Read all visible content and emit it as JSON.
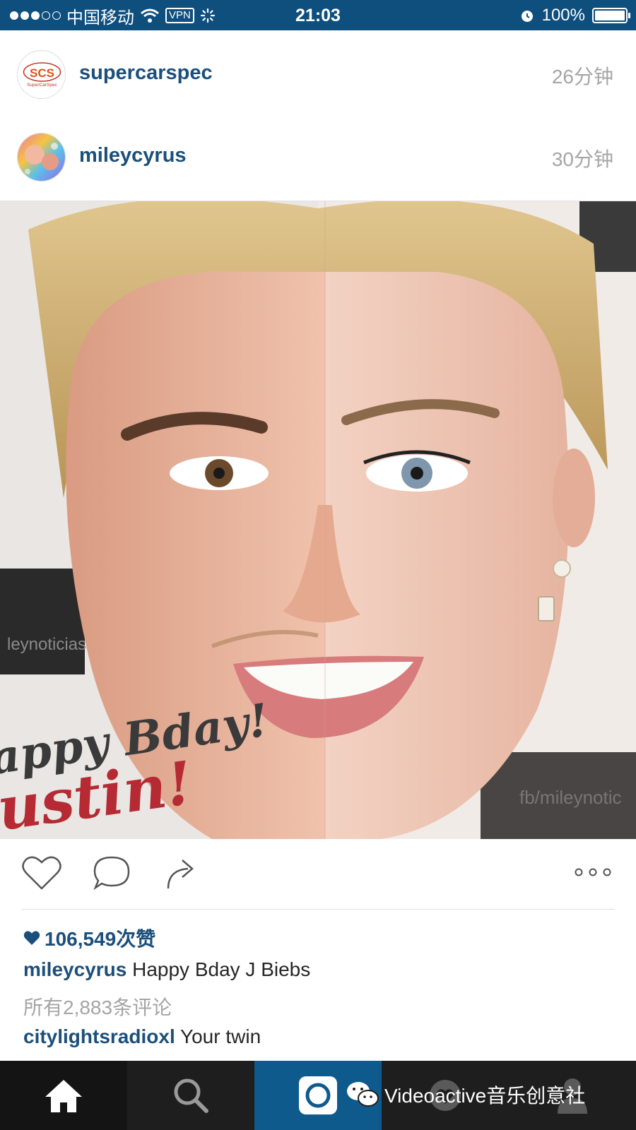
{
  "status_bar": {
    "carrier": "中国移动",
    "vpn": "VPN",
    "time": "21:03",
    "battery_text": "100%",
    "battery_level": 1.0,
    "signal_bars": 3,
    "signal_total": 5
  },
  "posts": [
    {
      "username": "supercarspec",
      "time_ago": "26分钟",
      "avatar_text": "SCS",
      "avatar_sub": "SuperCarSpec"
    },
    {
      "username": "mileycyrus",
      "time_ago": "30分钟"
    }
  ],
  "photo": {
    "overlay_line1": "appy Bday!",
    "overlay_line2": "ustin!",
    "watermark_left": "leynoticias",
    "watermark_right": "fb/mileynotic"
  },
  "actions": {
    "like_icon": "heart-icon",
    "comment_icon": "comment-icon",
    "share_icon": "share-icon",
    "more_icon": "more-icon"
  },
  "post_detail": {
    "likes": "106,549次赞",
    "caption_user": "mileycyrus",
    "caption_text": " Happy Bday J Biebs",
    "all_comments": "所有2,883条评论",
    "comment_user": "citylightsradioxl",
    "comment_text": " Your twin"
  },
  "tab_bar": {
    "tabs": [
      "home-icon",
      "search-icon",
      "camera-icon",
      "activity-icon",
      "profile-icon"
    ],
    "watermark_text": "Videoactive音乐创意社"
  },
  "colors": {
    "status_bar": "#0e4f7e",
    "username": "#1b4f7b",
    "tab_bar": "#1e1e1e",
    "camera_tab": "#0f5a8c"
  }
}
